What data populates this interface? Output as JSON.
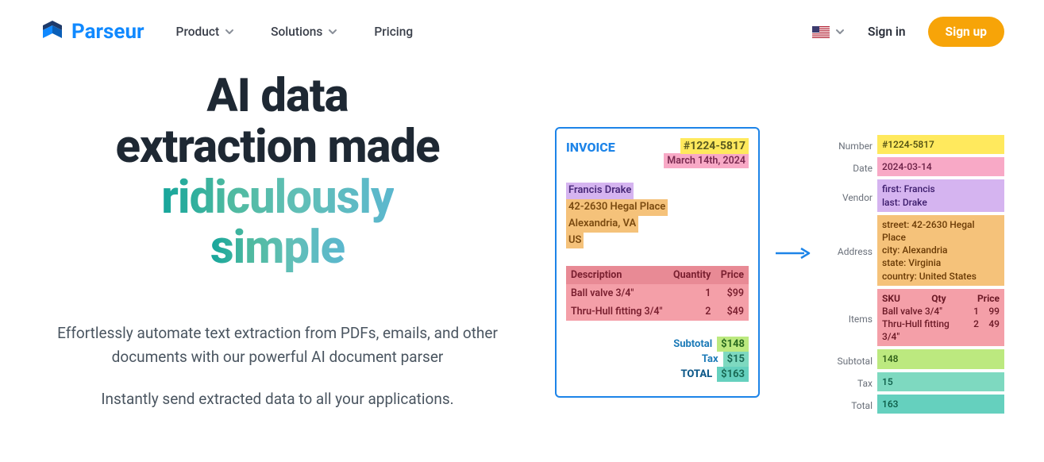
{
  "nav": {
    "brand": "Parseur",
    "items": [
      "Product",
      "Solutions",
      "Pricing"
    ],
    "signin": "Sign in",
    "signup": "Sign up"
  },
  "hero": {
    "line1": "AI data",
    "line2": "extraction made",
    "line3": "ridiculously",
    "line4": "simple",
    "sub1": "Effortlessly automate text extraction from PDFs, emails, and other documents with our powerful AI document parser",
    "sub2": "Instantly send extracted data to all your applications."
  },
  "invoice": {
    "title": "INVOICE",
    "id": "#1224-5817",
    "date": "March 14th, 2024",
    "addr_name": "Francis Drake",
    "addr_l1": "42-2630 Hegal Place",
    "addr_l2": "Alexandria, VA",
    "addr_l3": "US",
    "th1": "Description",
    "th2": "Quantity",
    "th3": "Price",
    "rows": [
      {
        "desc": "Ball valve 3/4\"",
        "qty": "1",
        "price": "$99"
      },
      {
        "desc": "Thru-Hull fitting 3/4\"",
        "qty": "2",
        "price": "$49"
      }
    ],
    "subtotal_lbl": "Subtotal",
    "subtotal": "$148",
    "tax_lbl": "Tax",
    "tax": "$15",
    "total_lbl": "TOTAL",
    "total": "$163"
  },
  "extracted": {
    "number_lbl": "Number",
    "number": "#1224-5817",
    "date_lbl": "Date",
    "date": "2024-03-14",
    "vendor_lbl": "Vendor",
    "vendor_first": "first: Francis",
    "vendor_last": "last: Drake",
    "address_lbl": "Address",
    "addr_street": "street: 42-2630 Hegal Place",
    "addr_city": "city: Alexandria",
    "addr_state": "state: Virginia",
    "addr_country": "country: United States",
    "items_lbl": "Items",
    "items_head_sku": "SKU",
    "items_head_qty": "Qty",
    "items_head_price": "Price",
    "items": [
      {
        "sku": "Ball valve 3/4\"",
        "qty": "1",
        "price": "99"
      },
      {
        "sku": "Thru-Hull fitting 3/4\"",
        "qty": "2",
        "price": "49"
      }
    ],
    "subtotal_lbl": "Subtotal",
    "subtotal": "148",
    "tax_lbl": "Tax",
    "tax": "15",
    "total_lbl": "Total",
    "total": "163"
  }
}
